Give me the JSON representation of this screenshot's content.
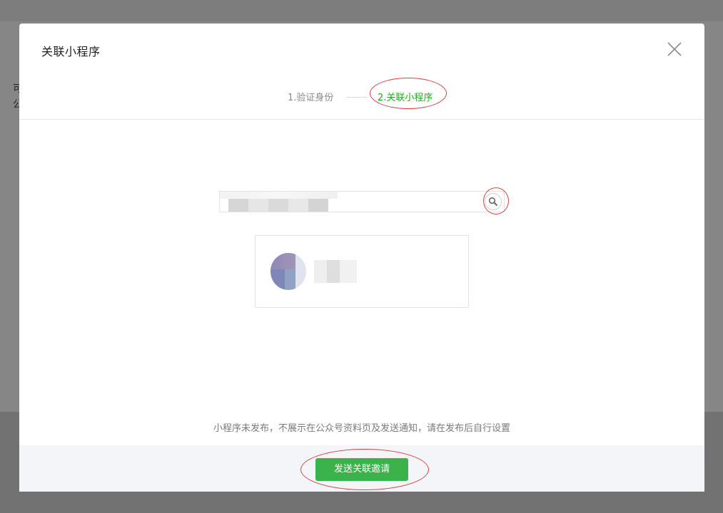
{
  "background": {
    "text_lines": [
      "可",
      "公"
    ]
  },
  "dialog": {
    "title": "关联小程序",
    "close_icon": "close-icon",
    "steps": [
      {
        "label": "1.验证身份",
        "state": "done"
      },
      {
        "label": "2.关联小程序",
        "state": "active"
      }
    ],
    "search": {
      "value": "",
      "icon": "search-icon"
    },
    "result": {
      "avatar": "mini-program-avatar",
      "name": ""
    },
    "notice": "小程序未发布，不展示在公众号资料页及发送通知，请在发布后自行设置",
    "primary_button": "发送关联邀请"
  },
  "colors": {
    "accent_green": "#1aad19",
    "button_green": "#3cb34a",
    "annotation_red": "#d94040"
  }
}
